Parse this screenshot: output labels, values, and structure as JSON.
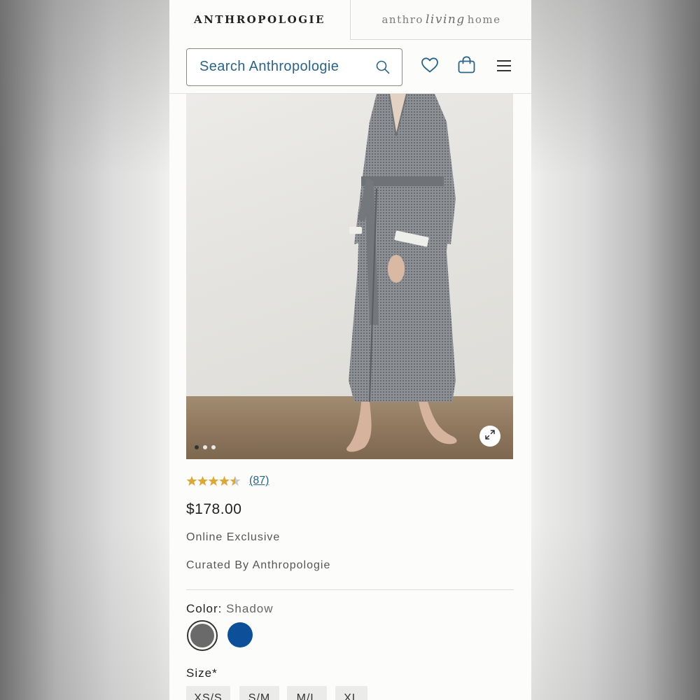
{
  "brand_tabs": {
    "anthropologie": "ANTHROPOLOGIE",
    "living_prefix": "anthro",
    "living_script": "living",
    "living_suffix": "home"
  },
  "header": {
    "search_placeholder": "Search Anthropologie",
    "icons": [
      "search-icon",
      "heart-icon",
      "shopping-bag-icon",
      "hamburger-menu-icon"
    ]
  },
  "gallery": {
    "slide_count": 3,
    "active_slide": 1,
    "expand_icon": "expand-icon"
  },
  "product": {
    "rating": 4.5,
    "review_count": "(87)",
    "price": "$178.00",
    "online_exclusive": "Online Exclusive",
    "curated": "Curated By Anthropologie"
  },
  "options": {
    "color_label": "Color:",
    "color_value": "Shadow",
    "swatches": [
      {
        "name": "Shadow",
        "hex": "#6a6a6a",
        "selected": true
      },
      {
        "name": "Blue",
        "hex": "#0e4f99",
        "selected": false
      }
    ],
    "size_label": "Size*",
    "sizes": [
      "XS/S",
      "S/M",
      "M/L",
      "XL"
    ]
  },
  "colors": {
    "accent_blue": "#2b6487",
    "star_gold": "#d9a93a",
    "text": "#222222"
  }
}
